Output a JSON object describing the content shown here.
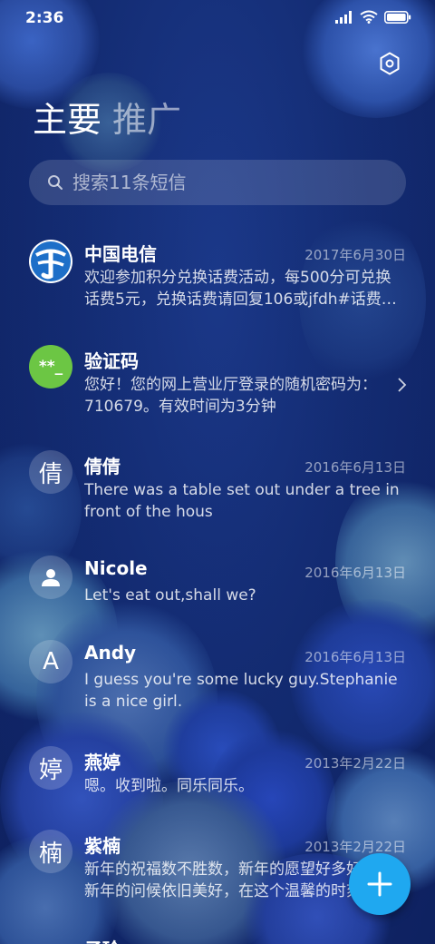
{
  "status_bar": {
    "time": "2:36"
  },
  "tabs": [
    {
      "label": "主要"
    },
    {
      "label": "推广"
    }
  ],
  "search": {
    "placeholder": "搜索11条短信"
  },
  "conversations": [
    {
      "name": "中国电信",
      "date": "2017年6月30日",
      "preview": "欢迎参加积分兑换话费活动，每500分可兑换话费5元，兑换话费请回复106或jfdh#话费…",
      "avatar": "china-telecom-logo"
    },
    {
      "name": "验证码",
      "date": "",
      "preview": "您好！您的网上营业厅登录的随机密码为：710679。有效时间为3分钟",
      "avatar_text": "**_"
    },
    {
      "name": "倩倩",
      "date": "2016年6月13日",
      "preview": "There was a table set out under a tree in front of the hous",
      "avatar_text": "倩"
    },
    {
      "name": "Nicole",
      "date": "2016年6月13日",
      "preview": "Let's eat out,shall we?",
      "avatar": "person-icon"
    },
    {
      "name": "Andy",
      "date": "2016年6月13日",
      "preview": "I guess you're some lucky guy.Stephanie is a nice girl.",
      "avatar_text": "A"
    },
    {
      "name": "燕婷",
      "date": "2013年2月22日",
      "preview": "嗯。收到啦。同乐同乐。",
      "avatar_text": "婷"
    },
    {
      "name": "紫楠",
      "date": "2013年2月22日",
      "preview": "新年的祝福数不胜数，新年的愿望好多好多，新年的问候依旧美好，在这个温馨的时刻",
      "avatar_text": "楠"
    },
    {
      "name": "子玲",
      "date": "",
      "preview": "",
      "avatar_text": ""
    }
  ],
  "colors": {
    "fab": "#1fa8f0",
    "verify_avatar": "#6cc644",
    "background": "#13286a"
  }
}
